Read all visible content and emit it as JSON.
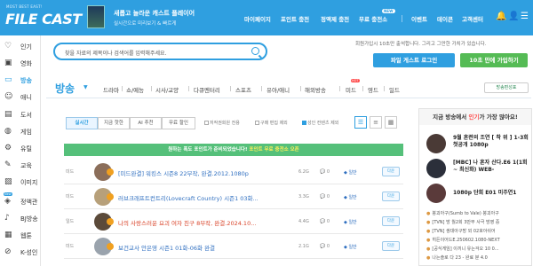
{
  "header": {
    "logo_tag": "MOST BEST EAST!",
    "logo": "FILE CAST",
    "promo_title": "새롭고 놀라운 캐스트 플레이어",
    "promo_sub": "실시간으로 미리보기 &  빠르게",
    "nav": [
      "마이페이지",
      "포인트 충전",
      "정액제 충전",
      "무료 충전소",
      "이벤트",
      "데이콘",
      "고객센터"
    ],
    "new_badge": "NEW"
  },
  "sidebar": {
    "items": [
      {
        "label": "인기",
        "icon": "heart-icon"
      },
      {
        "label": "영화",
        "icon": "film-icon"
      },
      {
        "label": "방송",
        "icon": "tv-icon"
      },
      {
        "label": "애니",
        "icon": "smile-icon"
      },
      {
        "label": "도서",
        "icon": "book-icon"
      },
      {
        "label": "게임",
        "icon": "gamepad-icon"
      },
      {
        "label": "유틸",
        "icon": "tool-icon"
      },
      {
        "label": "교육",
        "icon": "edu-icon"
      },
      {
        "label": "이미지",
        "icon": "image-icon"
      },
      {
        "label": "정액관",
        "icon": "pass-icon"
      },
      {
        "label": "BJ방송",
        "icon": "mic-icon"
      },
      {
        "label": "웹툰",
        "icon": "webtoon-icon"
      },
      {
        "label": "K-성인",
        "icon": "adult-icon"
      }
    ],
    "new_label": "New"
  },
  "search": {
    "placeholder": "찾을 자료의 제목이나 검색어를 입력해주세요."
  },
  "guest": {
    "message": "회원가입시 10초만 출석합니다. 그리고 그만한 가치가 있습니다.",
    "login": "파일 게스트 로그인",
    "join": "10초 만에 가입하기"
  },
  "category": {
    "title": "방송",
    "subs": [
      "드라마",
      "쇼/예능",
      "시사/교양",
      "다큐멘터리",
      "스포츠",
      "유아/애니",
      "해외방송",
      "미드",
      "영드",
      "일드"
    ],
    "hot": "HOT",
    "setting_btn": "방송편성표"
  },
  "tabs": [
    "실시간",
    "지금 핫한",
    "AI 추천",
    "무료 할인"
  ],
  "filters": [
    "저작권회원 전용",
    "구매 편집 제외",
    "성인 컨텐츠 제외"
  ],
  "notice": {
    "text": "원하는 폭도 포인트가 준비되었습니다!",
    "highlight": "포인트 무료 충전소 오픈"
  },
  "rows": [
    {
      "cat": "미드",
      "title": "[미드완결] 워킹스 시즌8 22부작, 완결.2012.1080p",
      "size": "6.2G",
      "cmt": "0",
      "seller": "일반",
      "dl": "다운"
    },
    {
      "cat": "미드",
      "title": "러브크래프트컨트리(Lovecraft Country) 시즌1 03화...",
      "size": "3.3G",
      "cmt": "0",
      "seller": "일반",
      "dl": "다운"
    },
    {
      "cat": "일드",
      "title": "나의 사랑스러운 요괴 여자 친구 8부작, 완결.2024.10...",
      "size": "4.4G",
      "cmt": "0",
      "seller": "일반",
      "dl": "다운"
    },
    {
      "cat": "미드",
      "title": "보건교사 안은영 시즌1 01화-06화 완결",
      "size": "2.1G",
      "cmt": "0",
      "seller": "일반",
      "dl": "다운"
    }
  ],
  "right_panel": {
    "head_pre": "지금 방송에서 ",
    "head_hl": "인기",
    "head_post": "가 가장 많아요!",
    "items": [
      "9월 흔련의 조연 [ 착 위 ] 1-3회 첫공개 1080p",
      "[MBC] 나 혼자 산다.E6 1(1회 ~ 최신화) WEB-",
      "1080p 단희 E01 미주연1"
    ],
    "lines": [
      "붕괴아구(Sumb to Vale) 붕괴아구",
      "[TVN] 방 월2회 3만부 사극 방영 중",
      "[TVN] 쌍대아구방 외 02호아쉬어",
      "히든이어드E.250602.1080-NEXT",
      "[공식게임] 이끼니 유는걱오 10 0...",
      "나는솔로 다 23 - 완료 분 4.0"
    ]
  }
}
